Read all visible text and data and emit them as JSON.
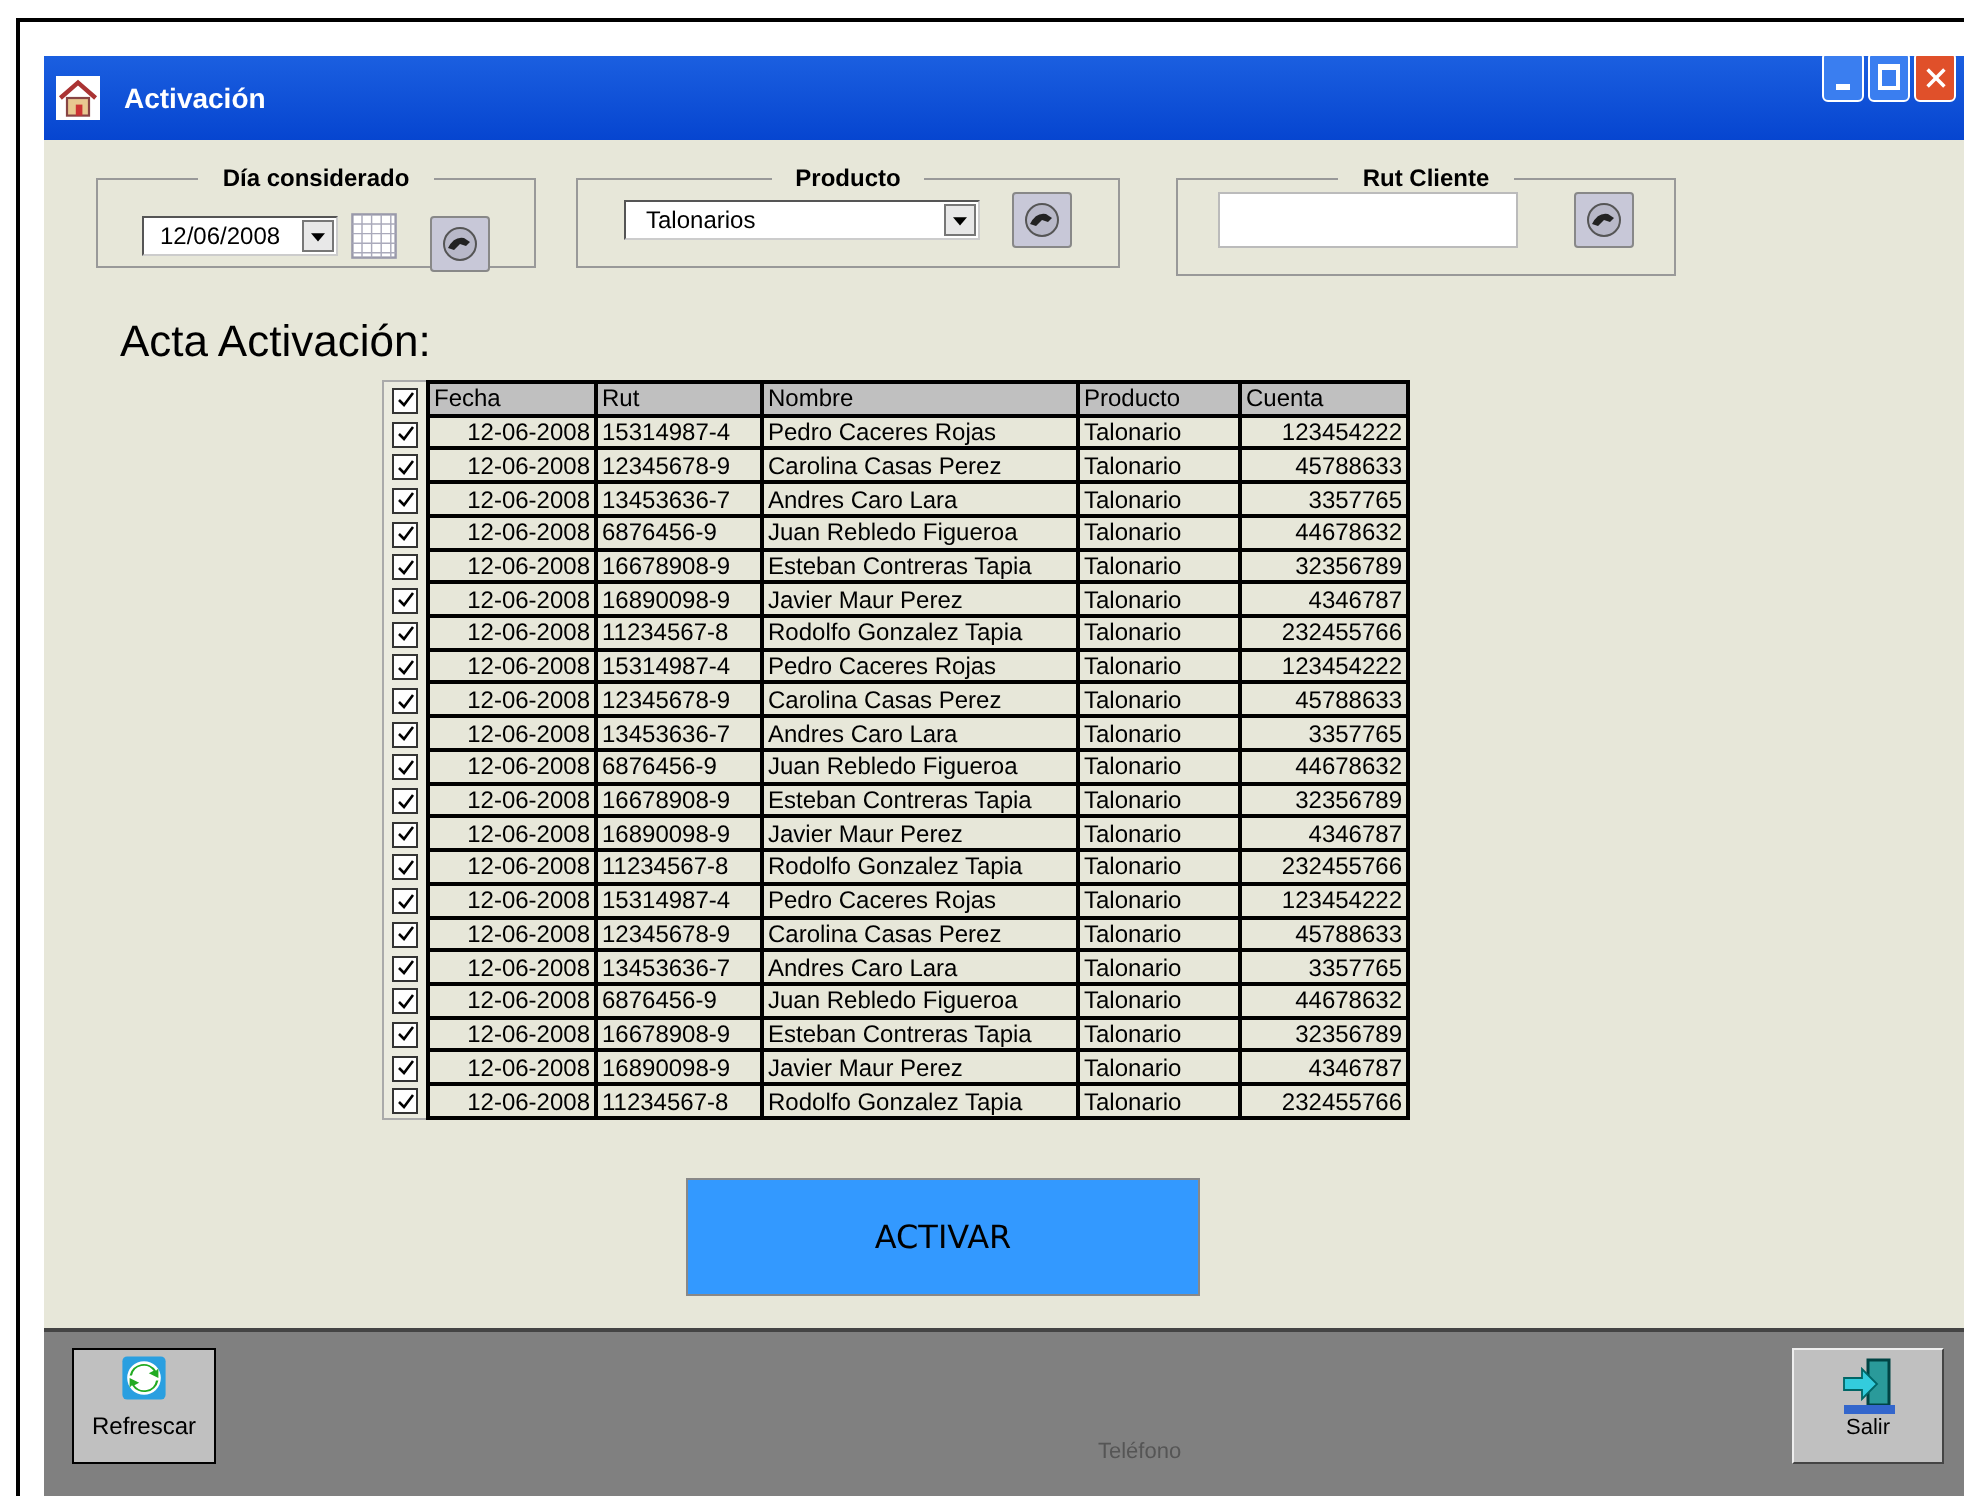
{
  "window": {
    "title": "Activación"
  },
  "filters": [
    {
      "kind": "date",
      "legend": "Día considerado",
      "value": "12/06/2008"
    },
    {
      "kind": "select",
      "legend": "Producto",
      "value": "Talonarios"
    },
    {
      "kind": "text",
      "legend": "Rut Cliente"
    }
  ],
  "heading": "Acta Activación:",
  "table": {
    "select_all": {
      "checked": true
    },
    "columns": [
      "Fecha",
      "Rut",
      "Nombre",
      "Producto",
      "Cuenta"
    ],
    "rows": [
      {
        "checked": true,
        "cells": [
          "12-06-2008",
          "15314987-4",
          "Pedro Caceres Rojas",
          "Talonario",
          "123454222"
        ]
      },
      {
        "checked": true,
        "cells": [
          "12-06-2008",
          "12345678-9",
          "Carolina Casas Perez",
          "Talonario",
          "45788633"
        ]
      },
      {
        "checked": true,
        "cells": [
          "12-06-2008",
          "13453636-7",
          "Andres Caro Lara",
          "Talonario",
          "3357765"
        ]
      },
      {
        "checked": true,
        "cells": [
          "12-06-2008",
          "6876456-9",
          "Juan Rebledo Figueroa",
          "Talonario",
          "44678632"
        ]
      },
      {
        "checked": true,
        "cells": [
          "12-06-2008",
          "16678908-9",
          "Esteban Contreras Tapia",
          "Talonario",
          "32356789"
        ]
      },
      {
        "checked": true,
        "cells": [
          "12-06-2008",
          "16890098-9",
          "Javier Maur Perez",
          "Talonario",
          "4346787"
        ]
      },
      {
        "checked": true,
        "cells": [
          "12-06-2008",
          "11234567-8",
          "Rodolfo Gonzalez Tapia",
          "Talonario",
          "232455766"
        ]
      },
      {
        "checked": true,
        "cells": [
          "12-06-2008",
          "15314987-4",
          "Pedro Caceres Rojas",
          "Talonario",
          "123454222"
        ]
      },
      {
        "checked": true,
        "cells": [
          "12-06-2008",
          "12345678-9",
          "Carolina Casas Perez",
          "Talonario",
          "45788633"
        ]
      },
      {
        "checked": true,
        "cells": [
          "12-06-2008",
          "13453636-7",
          "Andres Caro Lara",
          "Talonario",
          "3357765"
        ]
      },
      {
        "checked": true,
        "cells": [
          "12-06-2008",
          "6876456-9",
          "Juan Rebledo Figueroa",
          "Talonario",
          "44678632"
        ]
      },
      {
        "checked": true,
        "cells": [
          "12-06-2008",
          "16678908-9",
          "Esteban Contreras Tapia",
          "Talonario",
          "32356789"
        ]
      },
      {
        "checked": true,
        "cells": [
          "12-06-2008",
          "16890098-9",
          "Javier Maur Perez",
          "Talonario",
          "4346787"
        ]
      },
      {
        "checked": true,
        "cells": [
          "12-06-2008",
          "11234567-8",
          "Rodolfo Gonzalez Tapia",
          "Talonario",
          "232455766"
        ]
      },
      {
        "checked": true,
        "cells": [
          "12-06-2008",
          "15314987-4",
          "Pedro Caceres Rojas",
          "Talonario",
          "123454222"
        ]
      },
      {
        "checked": true,
        "cells": [
          "12-06-2008",
          "12345678-9",
          "Carolina Casas Perez",
          "Talonario",
          "45788633"
        ]
      },
      {
        "checked": true,
        "cells": [
          "12-06-2008",
          "13453636-7",
          "Andres Caro Lara",
          "Talonario",
          "3357765"
        ]
      },
      {
        "checked": true,
        "cells": [
          "12-06-2008",
          "6876456-9",
          "Juan Rebledo Figueroa",
          "Talonario",
          "44678632"
        ]
      },
      {
        "checked": true,
        "cells": [
          "12-06-2008",
          "16678908-9",
          "Esteban Contreras Tapia",
          "Talonario",
          "32356789"
        ]
      },
      {
        "checked": true,
        "cells": [
          "12-06-2008",
          "16890098-9",
          "Javier Maur Perez",
          "Talonario",
          "4346787"
        ]
      },
      {
        "checked": true,
        "cells": [
          "12-06-2008",
          "11234567-8",
          "Rodolfo Gonzalez Tapia",
          "Talonario",
          "232455766"
        ]
      }
    ]
  },
  "action_button": "ACTIVAR",
  "footer": {
    "refresh": "Refrescar",
    "status": "Teléfono",
    "exit": "Salir"
  }
}
